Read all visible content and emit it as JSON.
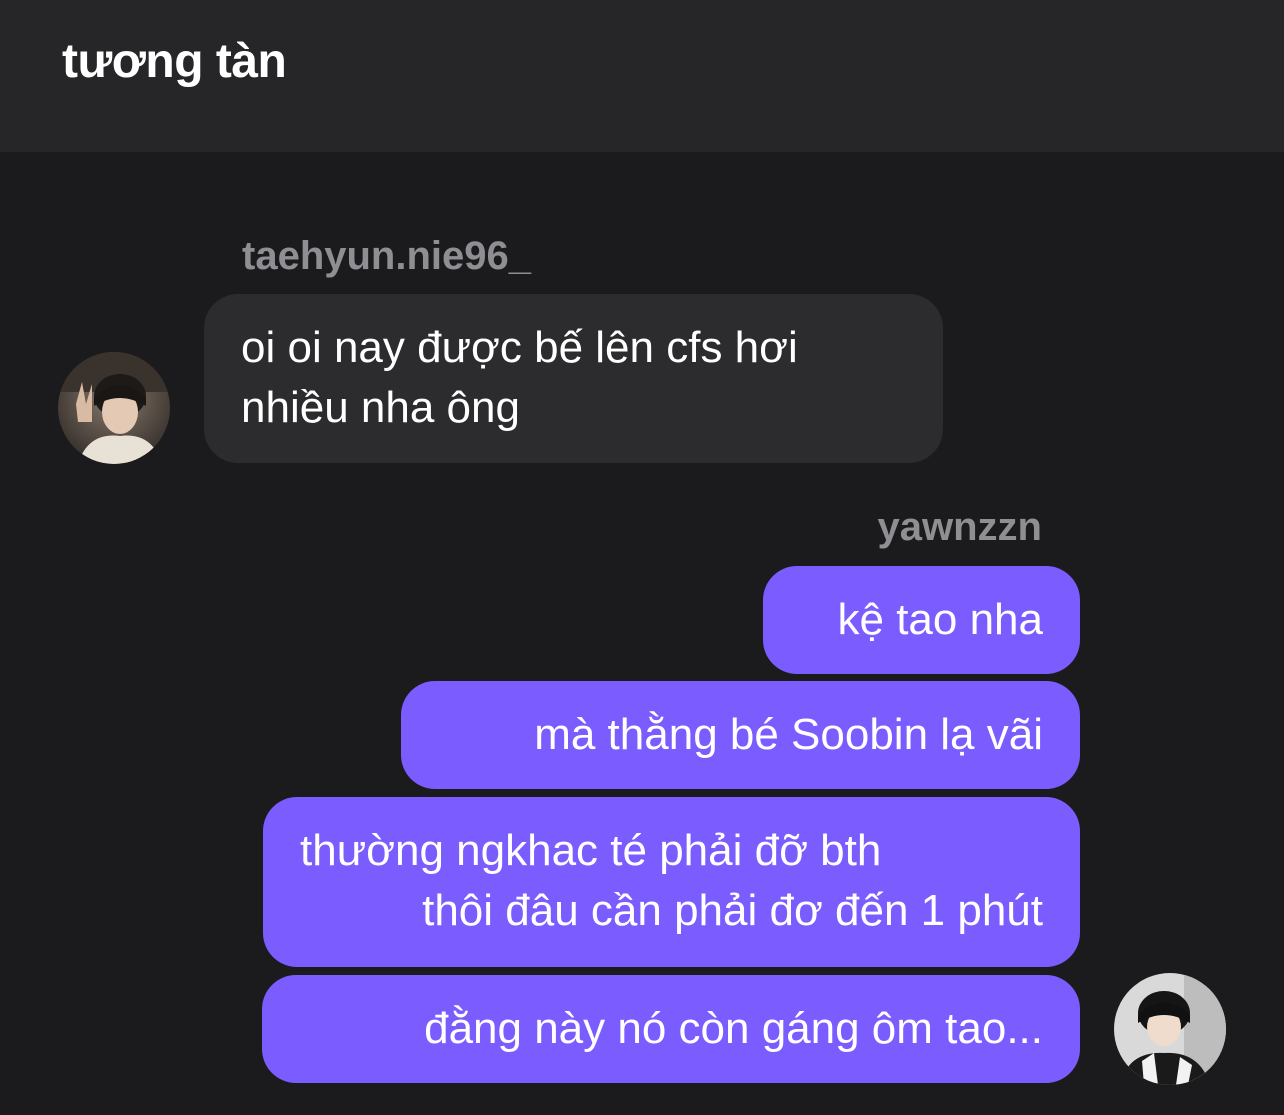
{
  "header": {
    "title": "tương tàn"
  },
  "messages": [
    {
      "sender": "taehyun.nie96_",
      "direction": "incoming",
      "lines": [
        "oi oi nay được bế lên cfs hơi",
        "nhiều nha ông"
      ]
    },
    {
      "sender": "yawnzzn",
      "direction": "outgoing",
      "bubbles": [
        {
          "lines": [
            "kệ tao nha"
          ]
        },
        {
          "lines": [
            "mà thằng bé Soobin lạ vãi"
          ]
        },
        {
          "lines": [
            "thường ngkhac té phải đỡ bth",
            "thôi đâu cần phải đơ đến 1 phút"
          ]
        },
        {
          "lines": [
            "đằng này nó còn gáng ôm tao..."
          ]
        }
      ]
    }
  ],
  "avatars": {
    "incoming": "avatar-photo",
    "outgoing": "avatar-photo"
  },
  "colors": {
    "background": "#1b1b1d",
    "header": "#262628",
    "incoming_bubble": "#2c2c2e",
    "outgoing_bubble": "#7b5cff",
    "sender_name": "#8e8e93",
    "text": "#ffffff"
  }
}
